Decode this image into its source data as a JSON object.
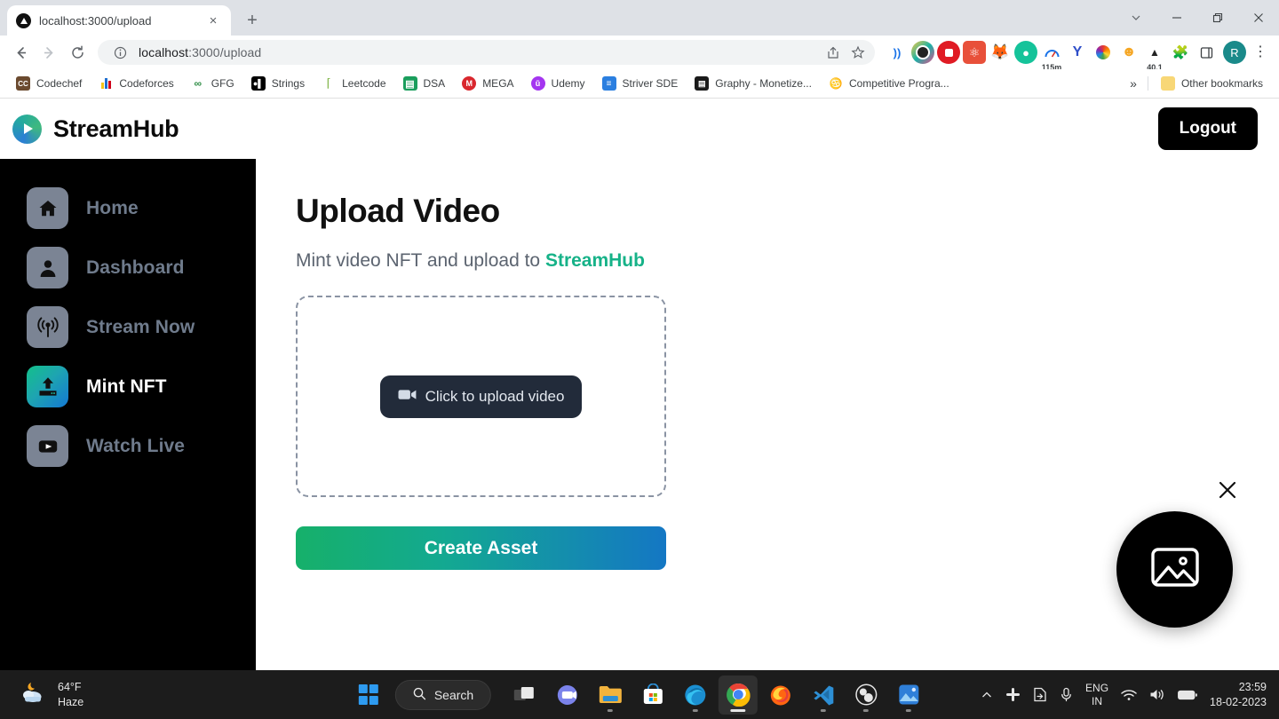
{
  "browser": {
    "tab": {
      "title": "localhost:3000/upload",
      "favicon": "play-circle-favicon",
      "close_label": "×"
    },
    "new_tab_label": "+",
    "window_controls": {
      "tab_search": "tab-search-chevron",
      "minimize": "minimize",
      "maximize": "restore",
      "close": "close"
    },
    "nav": {
      "back": "back-arrow",
      "forward": "forward-arrow",
      "reload": "reload-arrow"
    },
    "omnibox": {
      "info_icon": "site-info-icon",
      "url_host": "localhost",
      "url_path": ":3000/upload",
      "full_url": "localhost:3000/upload",
      "share_icon": "share-icon",
      "bookmark_icon": "star-icon"
    },
    "extensions": [
      {
        "name": "cast-icon",
        "glyph": "))",
        "color": "#1a73e8",
        "bg": "transparent",
        "badge": ""
      },
      {
        "name": "screen-recorder-icon",
        "glyph": "◉",
        "color": "#ffffff",
        "bg": "#8bc34a",
        "badge": ""
      },
      {
        "name": "adblock-icon",
        "glyph": "✋",
        "color": "#ffffff",
        "bg": "#e01b24",
        "badge": ""
      },
      {
        "name": "react-devtools-icon",
        "glyph": "⚛",
        "color": "#ffffff",
        "bg": "#e8503a",
        "badge": ""
      },
      {
        "name": "metamask-fox-icon",
        "glyph": "🦊",
        "color": "#f6851b",
        "bg": "transparent",
        "badge": ""
      },
      {
        "name": "grammarly-icon",
        "glyph": "🤖",
        "color": "#ffffff",
        "bg": "#15c39a",
        "badge": ""
      },
      {
        "name": "time-tracker-icon",
        "glyph": "◔",
        "color": "#1a73e8",
        "bg": "transparent",
        "badge": "115m"
      },
      {
        "name": "yandex-icon",
        "glyph": "Y",
        "color": "#3f51b5",
        "bg": "transparent",
        "badge": ""
      },
      {
        "name": "color-picker-icon",
        "glyph": "✿",
        "color": "#e91e63",
        "bg": "transparent",
        "badge": ""
      },
      {
        "name": "phantom-wallet-icon",
        "glyph": "👾",
        "color": "#f5a623",
        "bg": "transparent",
        "badge": ""
      },
      {
        "name": "speed-test-icon",
        "glyph": "▲",
        "color": "#222222",
        "bg": "transparent",
        "badge": "40.1"
      },
      {
        "name": "extensions-puzzle-icon",
        "glyph": "🧩",
        "color": "#5f6368",
        "bg": "transparent",
        "badge": ""
      },
      {
        "name": "side-panel-icon",
        "glyph": "▢",
        "color": "#3c4043",
        "bg": "transparent",
        "badge": ""
      }
    ],
    "profile_initial": "R",
    "menu_icon": "three-dot-menu-icon",
    "bookmarks": [
      {
        "label": "Codechef",
        "icon": "codechef-icon",
        "short": "CC",
        "bg": "#6b4a2f",
        "fg": "#ffffff"
      },
      {
        "label": "Codeforces",
        "icon": "codeforces-icon",
        "short": "▐▐",
        "bg": "#ffffff",
        "fg": "#1f6fd0"
      },
      {
        "label": "GFG",
        "icon": "gfg-icon",
        "short": "∞",
        "bg": "#ffffff",
        "fg": "#2f8d46"
      },
      {
        "label": "Strings",
        "icon": "strings-icon",
        "short": "●❙",
        "bg": "#000000",
        "fg": "#ffffff"
      },
      {
        "label": "Leetcode",
        "icon": "leetcode-icon",
        "short": "⊂",
        "bg": "#ffffff",
        "fg": "#6aa84f"
      },
      {
        "label": "DSA",
        "icon": "google-sheets-icon",
        "short": "┼",
        "bg": "#1a9e5c",
        "fg": "#ffffff"
      },
      {
        "label": "MEGA",
        "icon": "mega-icon",
        "short": "M",
        "bg": "#d9272e",
        "fg": "#ffffff"
      },
      {
        "label": "Udemy",
        "icon": "udemy-icon",
        "short": "ũ",
        "bg": "#a435f0",
        "fg": "#ffffff"
      },
      {
        "label": "Striver SDE",
        "icon": "google-docs-icon",
        "short": "≡",
        "bg": "#2b7fe0",
        "fg": "#ffffff"
      },
      {
        "label": "Graphy - Monetize...",
        "icon": "graphy-icon",
        "short": "▤",
        "bg": "#1a1a1a",
        "fg": "#ffffff"
      },
      {
        "label": "Competitive Progra...",
        "icon": "trophy-icon",
        "short": "♒",
        "bg": "#ffffff",
        "fg": "#1a7f6b"
      }
    ],
    "bookmarks_overflow": "»",
    "other_bookmarks": {
      "label": "Other bookmarks",
      "icon": "folder-icon"
    }
  },
  "app": {
    "brand": {
      "name": "StreamHub",
      "logo": "streamhub-play-logo"
    },
    "logout_label": "Logout",
    "sidebar": [
      {
        "label": "Home",
        "icon": "home-icon",
        "active": false
      },
      {
        "label": "Dashboard",
        "icon": "user-icon",
        "active": false
      },
      {
        "label": "Stream Now",
        "icon": "broadcast-icon",
        "active": false
      },
      {
        "label": "Mint NFT",
        "icon": "upload-icon",
        "active": true
      },
      {
        "label": "Watch Live",
        "icon": "play-rect-icon",
        "active": false
      }
    ],
    "main": {
      "title": "Upload Video",
      "subtitle_prefix": "Mint video NFT and upload to ",
      "subtitle_accent": "StreamHub",
      "accent_color": "#16b288",
      "upload_button_label": "Click to upload video",
      "upload_button_icon": "video-camera-icon",
      "create_button_label": "Create Asset"
    },
    "fab": {
      "icon": "image-icon",
      "close_icon": "close-x-icon"
    }
  },
  "taskbar": {
    "weather": {
      "temperature": "64°F",
      "condition": "Haze",
      "icon": "moon-cloud-icon"
    },
    "start_label": "start-button",
    "search_label": "Search",
    "search_icon": "search-icon",
    "apps": [
      {
        "name": "task-view",
        "open": false
      },
      {
        "name": "microsoft-teams",
        "open": false
      },
      {
        "name": "file-explorer",
        "open": true
      },
      {
        "name": "microsoft-store",
        "open": false
      },
      {
        "name": "microsoft-edge",
        "open": true
      },
      {
        "name": "google-chrome",
        "open": true,
        "active": true
      },
      {
        "name": "mozilla-firefox",
        "open": false
      },
      {
        "name": "visual-studio-code",
        "open": true
      },
      {
        "name": "obs-studio",
        "open": true
      },
      {
        "name": "photos",
        "open": true
      }
    ],
    "tray": {
      "overflow_icon": "chevron-up-icon",
      "slack_icon": "slack-icon",
      "onedrive_icon": "file-sync-icon",
      "mic_icon": "microphone-icon",
      "language_line1": "ENG",
      "language_line2": "IN",
      "wifi_icon": "wifi-icon",
      "volume_icon": "speaker-icon",
      "battery_icon": "battery-icon",
      "time": "23:59",
      "date": "18-02-2023"
    }
  }
}
